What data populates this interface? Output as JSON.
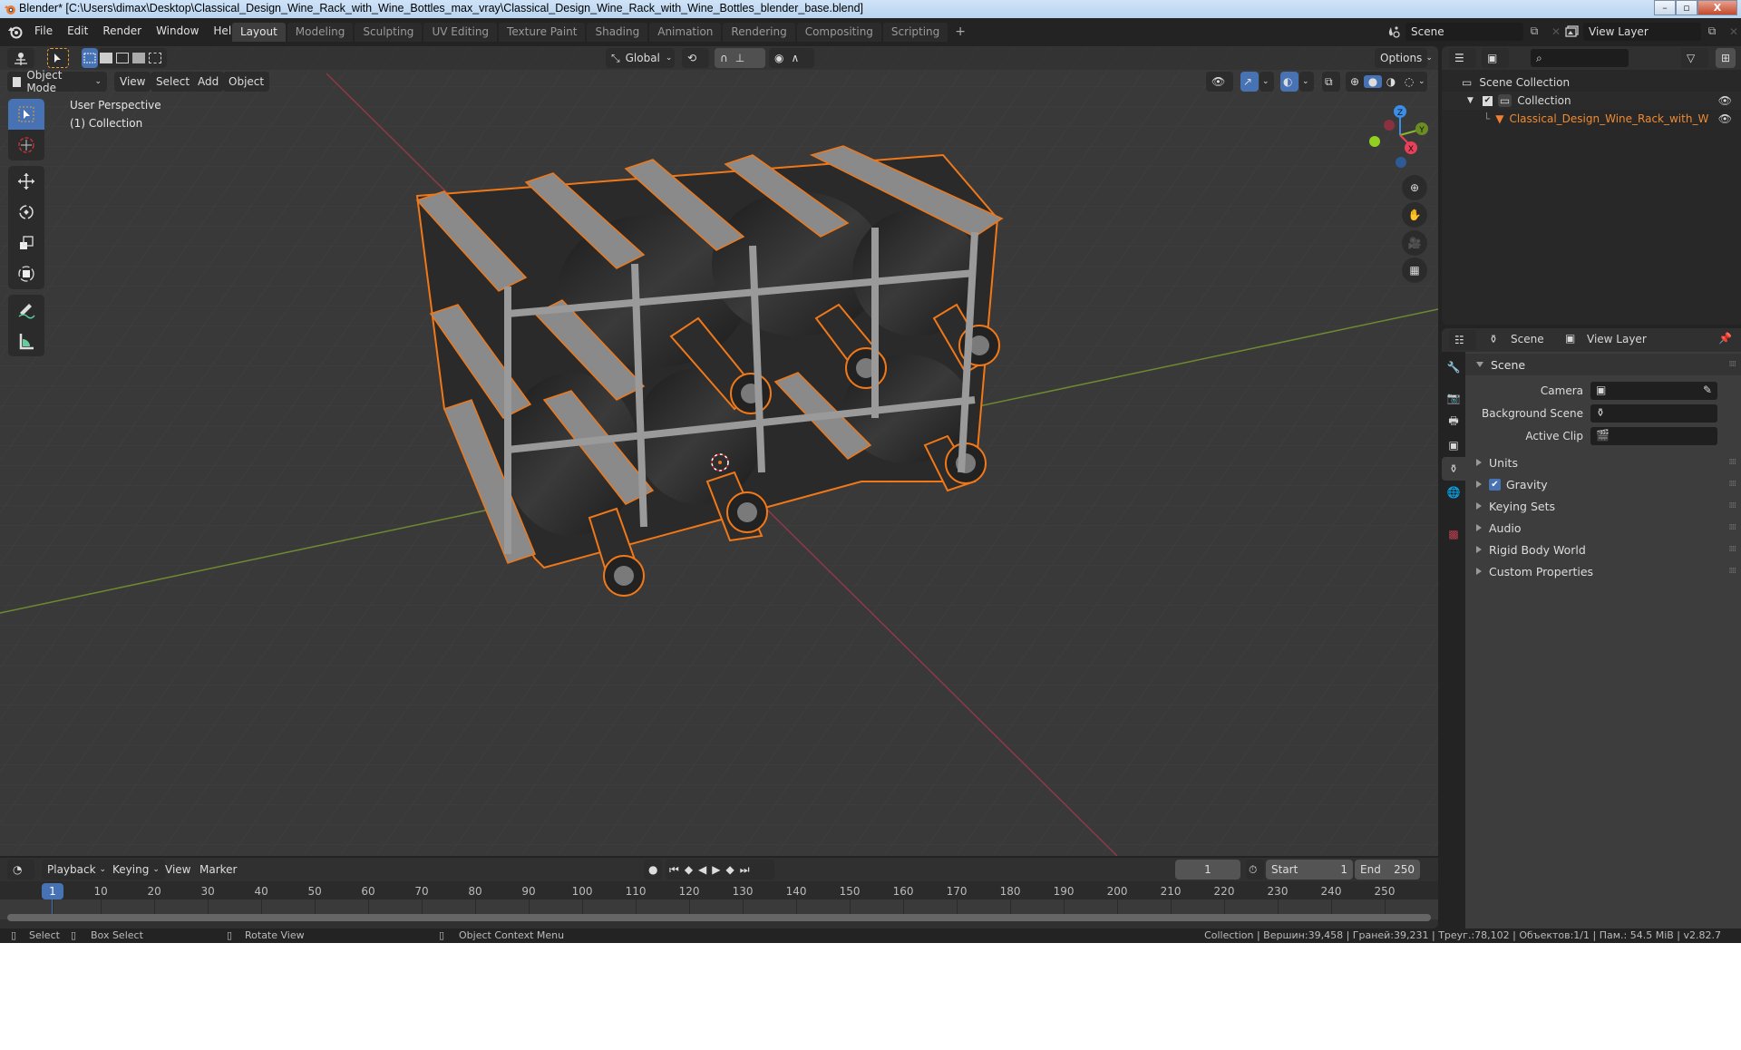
{
  "window": {
    "title": "Blender* [C:\\Users\\dimax\\Desktop\\Classical_Design_Wine_Rack_with_Wine_Bottles_max_vray\\Classical_Design_Wine_Rack_with_Wine_Bottles_blender_base.blend]",
    "minimize": "–",
    "maximize": "▫",
    "close": "X"
  },
  "menu": [
    "File",
    "Edit",
    "Render",
    "Window",
    "Help"
  ],
  "workspaces": [
    {
      "label": "Layout",
      "active": true
    },
    {
      "label": "Modeling"
    },
    {
      "label": "Sculpting"
    },
    {
      "label": "UV Editing"
    },
    {
      "label": "Texture Paint"
    },
    {
      "label": "Shading"
    },
    {
      "label": "Animation"
    },
    {
      "label": "Rendering"
    },
    {
      "label": "Compositing"
    },
    {
      "label": "Scripting"
    }
  ],
  "workspace_add": "+",
  "scene_selector": {
    "value": "Scene"
  },
  "view_layer_selector": {
    "value": "View Layer"
  },
  "viewport": {
    "transform_orientation": "Global",
    "options_label": "Options",
    "mode": "Object Mode",
    "header_menus": [
      "View",
      "Select",
      "Add",
      "Object"
    ],
    "overlay_text": {
      "perspective": "User Perspective",
      "collection": "(1) Collection"
    },
    "gizmo_axes": {
      "x": "X",
      "y": "Y",
      "z": "Z"
    },
    "colors": {
      "x_axis": "#e8405a",
      "y_axis": "#8ab82c",
      "z_axis": "#3b8ee8",
      "selection_outline": "#f07818",
      "active_blue": "#4772b3"
    },
    "shading_mode": "solid"
  },
  "toolbar": {
    "tools": [
      "select-box",
      "cursor",
      "move",
      "rotate",
      "scale",
      "transform",
      "annotate",
      "measure"
    ],
    "active": "select-box"
  },
  "outliner": {
    "search_placeholder": "",
    "items": [
      {
        "label": "Scene Collection",
        "depth": 0
      },
      {
        "label": "Collection",
        "depth": 1,
        "checked": true,
        "visible": true
      },
      {
        "label": "Classical_Design_Wine_Rack_with_Wine_Bo",
        "depth": 2,
        "visible": true,
        "selected": true
      }
    ]
  },
  "properties": {
    "breadcrumb": {
      "scene": "Scene",
      "view_layer": "View Layer"
    },
    "panel_title": "Scene",
    "fields": [
      {
        "label": "Camera",
        "value": ""
      },
      {
        "label": "Background Scene",
        "value": ""
      },
      {
        "label": "Active Clip",
        "value": ""
      }
    ],
    "subpanels": [
      {
        "label": "Units"
      },
      {
        "label": "Gravity",
        "checkbox": true,
        "checked": true
      },
      {
        "label": "Keying Sets"
      },
      {
        "label": "Audio"
      },
      {
        "label": "Rigid Body World"
      },
      {
        "label": "Custom Properties"
      }
    ]
  },
  "timeline": {
    "menus": [
      "Playback",
      "Keying",
      "View",
      "Marker"
    ],
    "current_frame": "1",
    "start_label": "Start",
    "start": "1",
    "end_label": "End",
    "end": "250",
    "ticks": [
      "1",
      "10",
      "20",
      "30",
      "40",
      "50",
      "60",
      "70",
      "80",
      "90",
      "100",
      "110",
      "120",
      "130",
      "140",
      "150",
      "160",
      "170",
      "180",
      "190",
      "200",
      "210",
      "220",
      "230",
      "240",
      "250"
    ]
  },
  "statusbar": {
    "select": "Select",
    "box_select": "Box Select",
    "rotate_view": "Rotate View",
    "context_menu": "Object Context Menu",
    "stats": "Collection | Вершин:39,458 | Граней:39,231 | Треуг.:78,102 | Объектов:1/1 | Пам.: 54.5 MiB | v2.82.7"
  }
}
